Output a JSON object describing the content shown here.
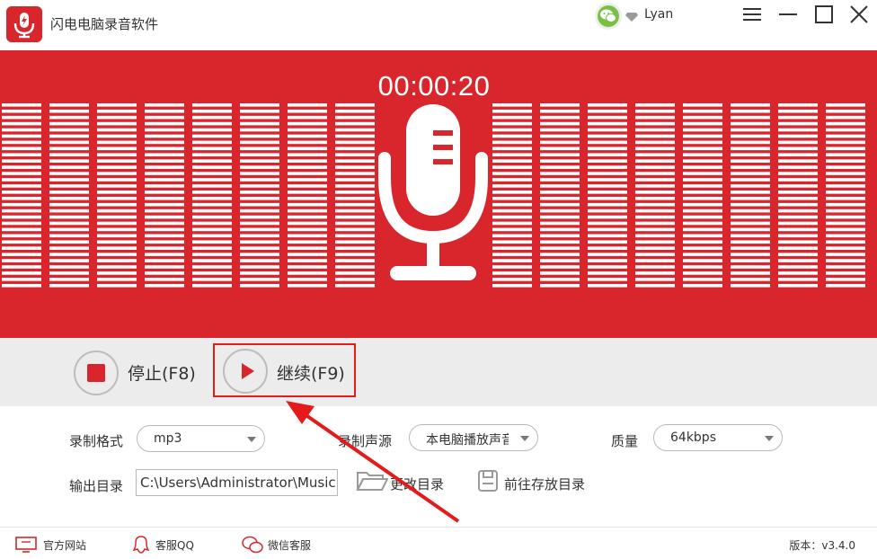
{
  "app": {
    "title": "闪电电脑录音软件"
  },
  "user": {
    "name": "Lyan"
  },
  "recorder": {
    "timer": "00:00:20"
  },
  "controls": {
    "stop_label": "停止(F8)",
    "resume_label": "继续(F9)"
  },
  "settings": {
    "format_label": "录制格式",
    "format_value": "mp3",
    "source_label": "录制声源",
    "source_value": "本电脑播放声音",
    "quality_label": "质量",
    "quality_value": "64kbps",
    "output_label": "输出目录",
    "output_value": "C:\\Users\\Administrator\\Music",
    "change_dir_label": "更改目录",
    "open_dir_label": "前往存放目录"
  },
  "footer": {
    "website": "官方网站",
    "qq": "客服QQ",
    "wechat": "微信客服",
    "version": "版本：v3.4.0"
  },
  "colors": {
    "brand_red": "#d8262c",
    "annotation_red": "#e31b1b",
    "control_strip": "#ececec"
  },
  "icons": [
    "app-logo-icon",
    "wechat-icon",
    "vip-diamond-icon",
    "menu-icon",
    "minimize-icon",
    "maximize-icon",
    "close-icon",
    "microphone-icon",
    "stop-icon",
    "play-icon",
    "folder-icon",
    "save-icon",
    "monitor-icon",
    "qq-icon",
    "wechat-service-icon"
  ]
}
